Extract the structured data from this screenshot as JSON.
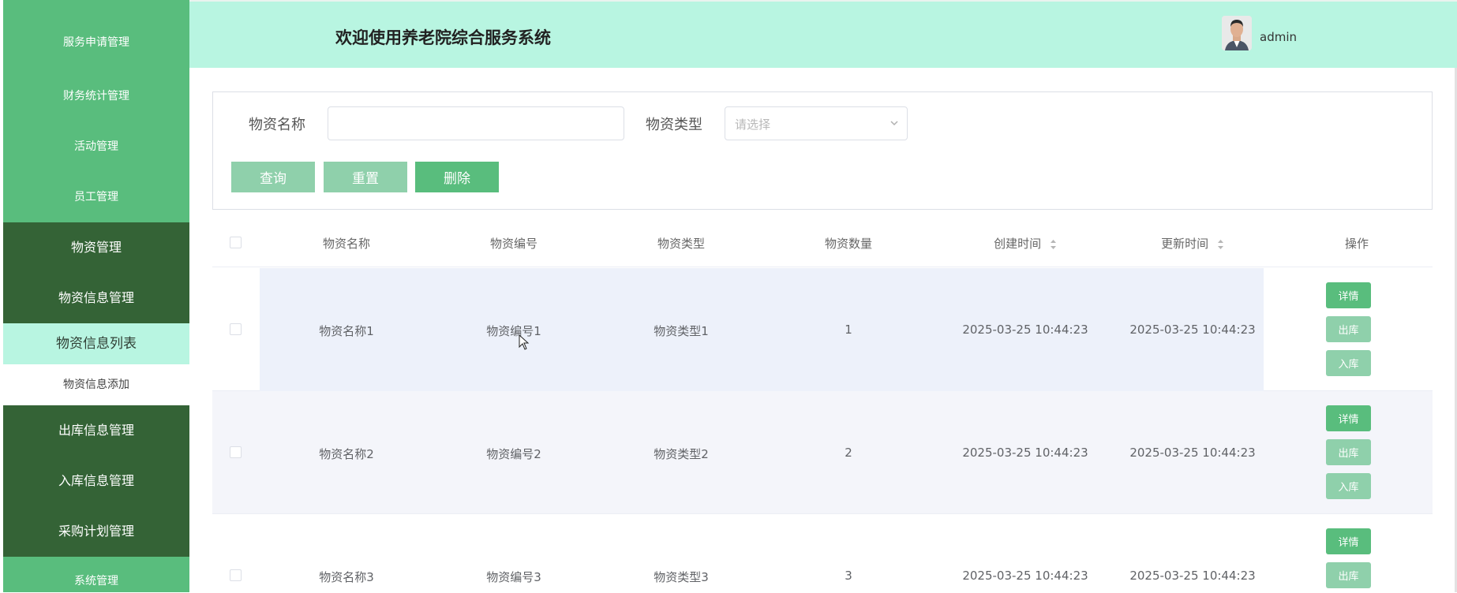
{
  "sidebar": {
    "cut_label": "",
    "items": [
      {
        "label": "服务申请管理"
      },
      {
        "label": "财务统计管理"
      },
      {
        "label": "活动管理"
      },
      {
        "label": "员工管理"
      },
      {
        "label": "物资管理"
      },
      {
        "label": "物资信息管理"
      },
      {
        "label": "物资信息列表"
      },
      {
        "label": "物资信息添加"
      },
      {
        "label": "出库信息管理"
      },
      {
        "label": "入库信息管理"
      },
      {
        "label": "采购计划管理"
      },
      {
        "label": "系统管理"
      }
    ]
  },
  "header": {
    "title": "欢迎使用养老院综合服务系统",
    "username": "admin"
  },
  "search": {
    "name_label": "物资名称",
    "name_value": "",
    "type_label": "物资类型",
    "type_placeholder": "请选择",
    "query_button": "查询",
    "reset_button": "重置",
    "delete_button": "删除"
  },
  "table": {
    "columns": [
      "物资名称",
      "物资编号",
      "物资类型",
      "物资数量",
      "创建时间",
      "更新时间",
      "操作"
    ],
    "rows": [
      {
        "name": "物资名称1",
        "code": "物资编号1",
        "type": "物资类型1",
        "qty": "1",
        "created": "2025-03-25 10:44:23",
        "updated": "2025-03-25 10:44:23"
      },
      {
        "name": "物资名称2",
        "code": "物资编号2",
        "type": "物资类型2",
        "qty": "2",
        "created": "2025-03-25 10:44:23",
        "updated": "2025-03-25 10:44:23"
      },
      {
        "name": "物资名称3",
        "code": "物资编号3",
        "type": "物资类型3",
        "qty": "3",
        "created": "2025-03-25 10:44:23",
        "updated": "2025-03-25 10:44:23"
      }
    ],
    "actions": {
      "detail": "详情",
      "out": "出库",
      "in": "入库"
    }
  },
  "colors": {
    "sidebar_green": "#59bd7d",
    "sidebar_dark": "#346336",
    "header_mint": "#b8f5e1",
    "hover_row": "#edf1fa",
    "striped_row": "#f4f5fa"
  }
}
